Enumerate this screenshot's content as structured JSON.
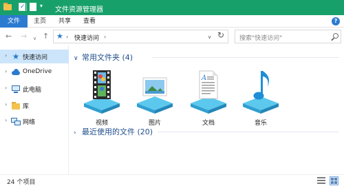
{
  "window": {
    "title": "文件资源管理器",
    "accent": "#18a06a"
  },
  "ribbon": {
    "tabs": [
      {
        "label": "文件"
      },
      {
        "label": "主页"
      },
      {
        "label": "共享"
      },
      {
        "label": "查看"
      }
    ],
    "help_label": "?"
  },
  "nav": {
    "address_text": "快速访问",
    "search_placeholder": "搜索\"快速访问\""
  },
  "sidebar": {
    "items": [
      {
        "label": "快速访问",
        "icon": "star-icon",
        "selected": true
      },
      {
        "label": "OneDrive",
        "icon": "cloud-icon"
      },
      {
        "label": "此电脑",
        "icon": "computer-icon"
      },
      {
        "label": "库",
        "icon": "library-folder-icon"
      },
      {
        "label": "网络",
        "icon": "network-icon"
      }
    ]
  },
  "main": {
    "frequent_folders": {
      "title": "常用文件夹 (4)",
      "items": [
        {
          "label": "视频",
          "icon": "video-film-icon"
        },
        {
          "label": "图片",
          "icon": "picture-icon"
        },
        {
          "label": "文档",
          "icon": "document-icon"
        },
        {
          "label": "音乐",
          "icon": "music-note-icon"
        }
      ]
    },
    "recent_files": {
      "title": "最近使用的文件 (20)"
    }
  },
  "status": {
    "item_count": "24 个项目"
  }
}
